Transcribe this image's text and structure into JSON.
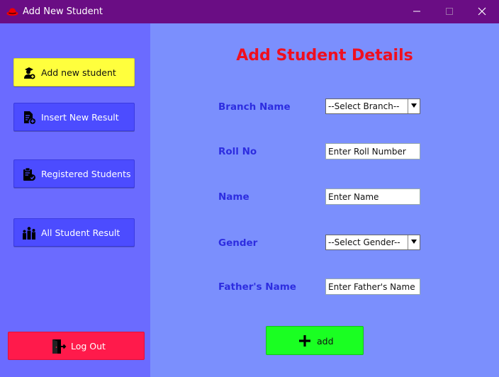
{
  "window": {
    "title": "Add New Student"
  },
  "sidebar": {
    "items": [
      {
        "label": "Add new student",
        "icon": "student-add-icon",
        "active": true
      },
      {
        "label": "Insert New Result",
        "icon": "document-add-icon",
        "active": false
      },
      {
        "label": "Registered Students",
        "icon": "clipboard-check-icon",
        "active": false
      },
      {
        "label": "All Student Result",
        "icon": "group-icon",
        "active": false
      }
    ],
    "logout_label": "Log Out"
  },
  "form": {
    "heading": "Add Student Details",
    "branch": {
      "label": "Branch Name",
      "value": "--Select Branch--"
    },
    "roll": {
      "label": "Roll No",
      "value": "Enter Roll Number"
    },
    "name": {
      "label": "Name",
      "value": "Enter Name"
    },
    "gender": {
      "label": "Gender",
      "value": "--Select Gender--"
    },
    "father": {
      "label": "Father's Name",
      "value": "Enter Father's Name"
    },
    "add_label": "add"
  },
  "colors": {
    "titlebar": "#6a0d84",
    "sidebar": "#6b6bff",
    "main": "#7b8ffd",
    "nav_button": "#4c4cff",
    "active_button": "#ffff3d",
    "logout_button": "#ff1a4b",
    "add_button": "#1aff22",
    "heading": "#ef0f1f",
    "label": "#2d2de0"
  }
}
